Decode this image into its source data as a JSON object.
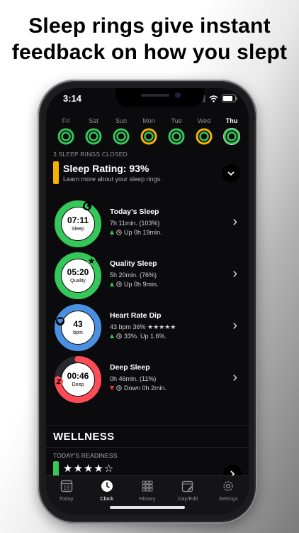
{
  "headline": {
    "line1": "Sleep rings give instant",
    "line2": "feedback on how you slept"
  },
  "status": {
    "time": "3:14"
  },
  "week": [
    {
      "label": "Fri",
      "color": "#34c759",
      "active": false
    },
    {
      "label": "Sat",
      "color": "#34c759",
      "active": false
    },
    {
      "label": "Sun",
      "color": "#34c759",
      "active": false
    },
    {
      "label": "Mon",
      "color": "#f5b300",
      "active": false
    },
    {
      "label": "Tue",
      "color": "#34c759",
      "active": false
    },
    {
      "label": "Wed",
      "color": "#f5b300",
      "active": false
    },
    {
      "label": "Thu",
      "color": "#34c759",
      "active": true
    }
  ],
  "rings_closed": "3 SLEEP RINGS CLOSED",
  "rating": {
    "title": "Sleep Rating: 93%",
    "subtitle": "Learn more about your sleep rings.",
    "color": "#f5b300"
  },
  "metrics": [
    {
      "center_value": "07:11",
      "center_label": "Sleep",
      "title": "Today's Sleep",
      "line1": "7h 11min. (103%)",
      "trend": "up",
      "line2": "Up 0h 19min.",
      "ring_color": "#34c759",
      "fill": 1.0,
      "badge": "moon-icon"
    },
    {
      "center_value": "05:20",
      "center_label": "Quality",
      "title": "Quality Sleep",
      "line1": "5h 20min. (76%)",
      "trend": "up",
      "line2": "Up 0h 9min.",
      "ring_color": "#34c759",
      "fill": 1.0,
      "badge": "star-icon"
    },
    {
      "center_value": "43",
      "center_label": "bpm",
      "title": "Heart Rate Dip",
      "line1": "43 bpm 36% ★★★★★",
      "trend": "up",
      "line2": "33%. Up 1.6%.",
      "ring_color": "#4a90e2",
      "fill": 1.0,
      "badge": "heart-icon"
    },
    {
      "center_value": "00:46",
      "center_label": "Deep",
      "title": "Deep Sleep",
      "line1": "0h 46min. (11%)",
      "trend": "down",
      "line2": "Down 0h 2min.",
      "ring_color": "#ff4b55",
      "fill": 0.75,
      "badge": "z-icon"
    }
  ],
  "wellness": {
    "heading": "WELLNESS",
    "readiness_label": "TODAY'S READINESS",
    "readiness_stars": "★★★★☆",
    "readiness_color": "#34c759"
  },
  "tabs": [
    {
      "label": "Today",
      "icon": "calendar-icon",
      "date": "19",
      "active": false
    },
    {
      "label": "Clock",
      "icon": "clock-icon",
      "active": true
    },
    {
      "label": "History",
      "icon": "grid-icon",
      "active": false
    },
    {
      "label": "Day/Edit",
      "icon": "edit-calendar-icon",
      "active": false
    },
    {
      "label": "Settings",
      "icon": "gear-icon",
      "active": false
    }
  ]
}
